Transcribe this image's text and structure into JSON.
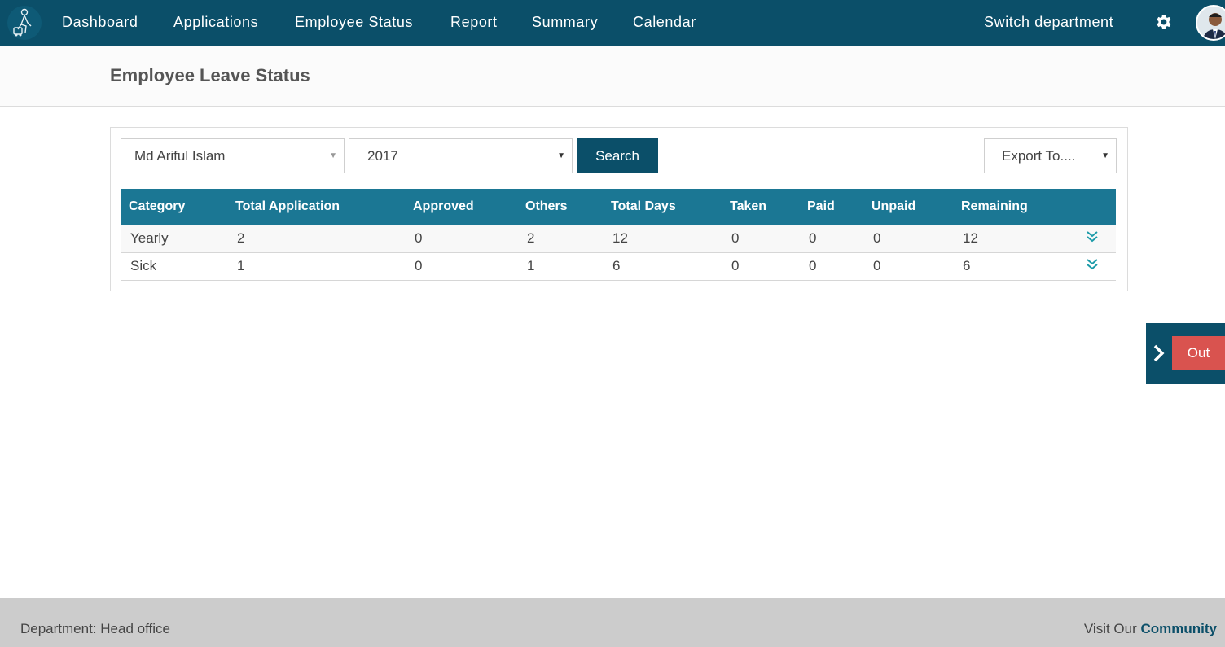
{
  "nav": {
    "items": [
      {
        "label": "Dashboard"
      },
      {
        "label": "Applications"
      },
      {
        "label": "Employee Status"
      },
      {
        "label": "Report"
      },
      {
        "label": "Summary"
      },
      {
        "label": "Calendar"
      }
    ],
    "switch_department": "Switch department",
    "icons": [
      "logo-icon",
      "gear-icon",
      "avatar"
    ]
  },
  "page": {
    "title": "Employee Leave Status"
  },
  "filters": {
    "employee": "Md Ariful Islam",
    "year": "2017",
    "search_label": "Search",
    "export_label": "Export To...."
  },
  "table": {
    "headers": [
      "Category",
      "Total Application",
      "Approved",
      "Others",
      "Total Days",
      "Taken",
      "Paid",
      "Unpaid",
      "Remaining"
    ],
    "rows": [
      {
        "category": "Yearly",
        "total_application": "2",
        "approved": "0",
        "others": "2",
        "total_days": "12",
        "taken": "0",
        "paid": "0",
        "unpaid": "0",
        "remaining": "12"
      },
      {
        "category": "Sick",
        "total_application": "1",
        "approved": "0",
        "others": "1",
        "total_days": "6",
        "taken": "0",
        "paid": "0",
        "unpaid": "0",
        "remaining": "6"
      }
    ]
  },
  "side": {
    "out_label": "Out"
  },
  "footer": {
    "department": "Department: Head office",
    "visit_prefix": "Visit Our",
    "community": "Community"
  },
  "colors": {
    "nav_bg": "#0b4f69",
    "table_header_bg": "#1b7794",
    "out_button": "#d9534f",
    "footer_bg": "#cccccc",
    "expand_icon": "#1b9aa8"
  }
}
